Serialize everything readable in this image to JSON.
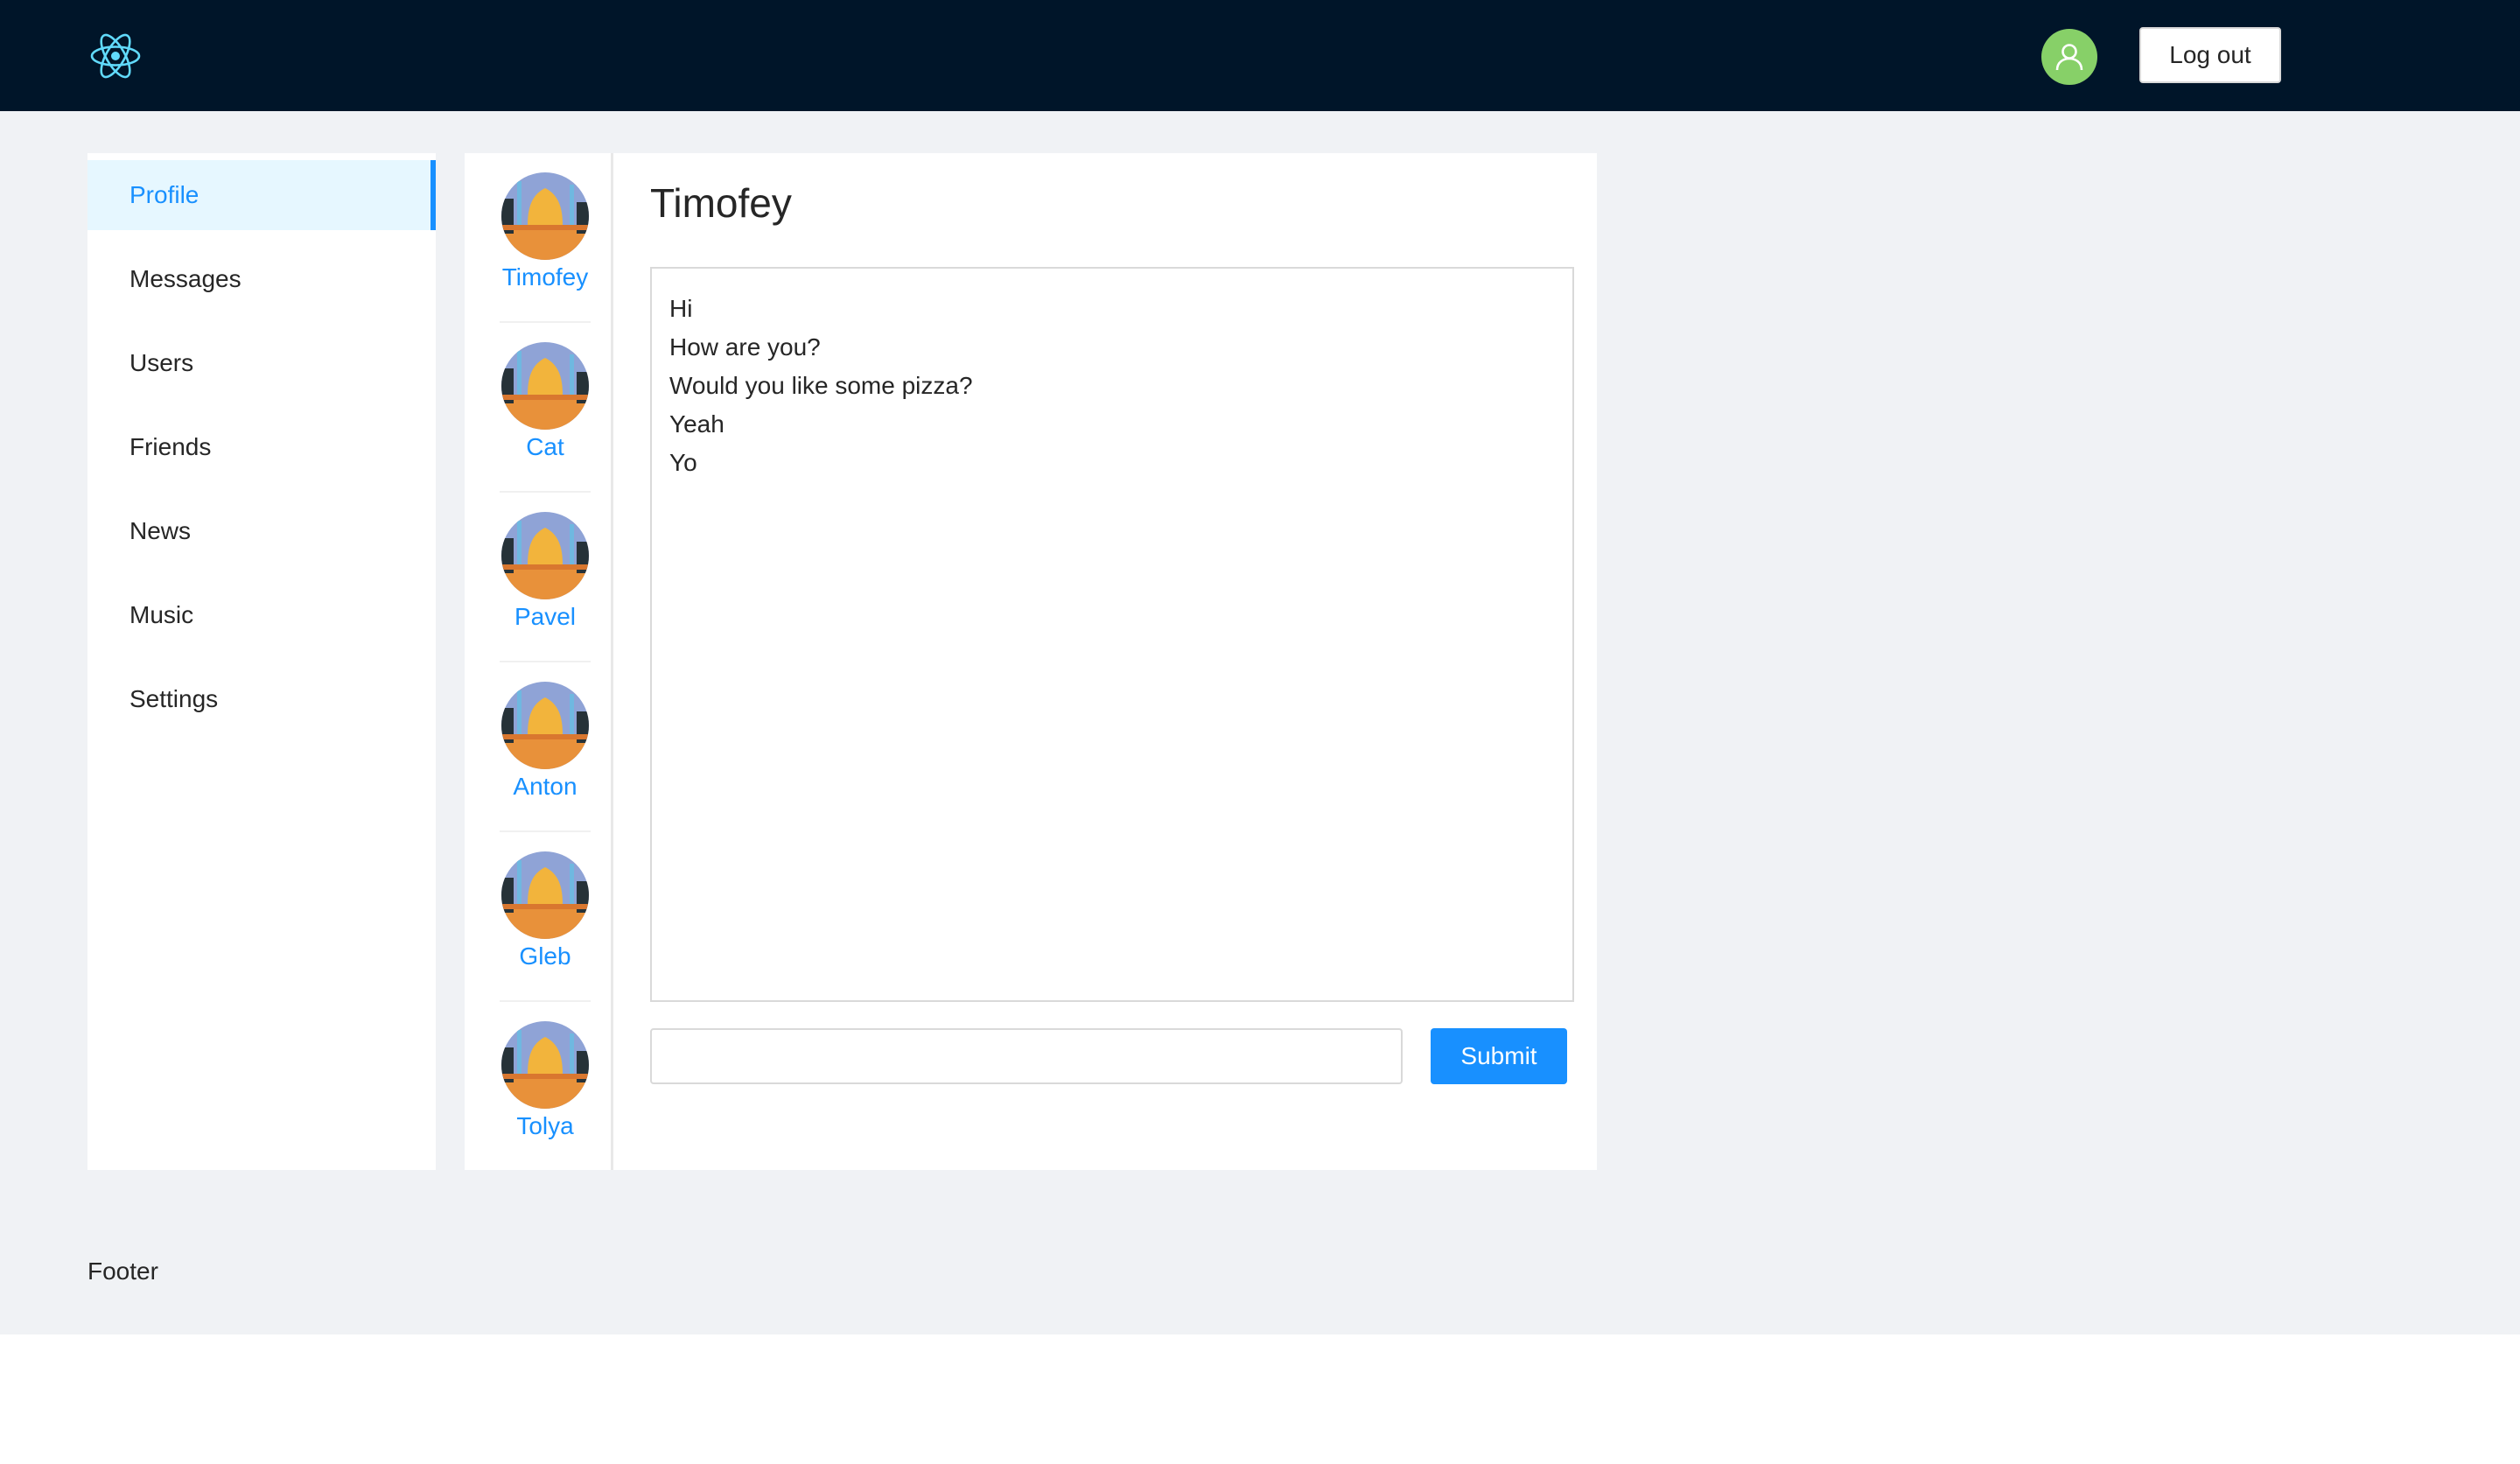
{
  "header": {
    "logo_icon": "react-atom-icon",
    "avatar_icon": "user-icon",
    "logout_label": "Log out",
    "colors": {
      "background": "#001529",
      "avatar": "#87d068"
    }
  },
  "sidebar": {
    "items": [
      {
        "label": "Profile",
        "active": true
      },
      {
        "label": "Messages",
        "active": false
      },
      {
        "label": "Users",
        "active": false
      },
      {
        "label": "Friends",
        "active": false
      },
      {
        "label": "News",
        "active": false
      },
      {
        "label": "Music",
        "active": false
      },
      {
        "label": "Settings",
        "active": false
      }
    ],
    "accent": "#1890ff"
  },
  "dialogs": [
    {
      "name": "Timofey"
    },
    {
      "name": "Cat"
    },
    {
      "name": "Pavel"
    },
    {
      "name": "Anton"
    },
    {
      "name": "Gleb"
    },
    {
      "name": "Tolya"
    }
  ],
  "chat": {
    "title": "Timofey",
    "messages": [
      "Hi",
      "How are you?",
      "Would you like some pizza?",
      "Yeah",
      "Yo"
    ],
    "input_value": "",
    "submit_label": "Submit"
  },
  "footer": {
    "text": "Footer"
  }
}
